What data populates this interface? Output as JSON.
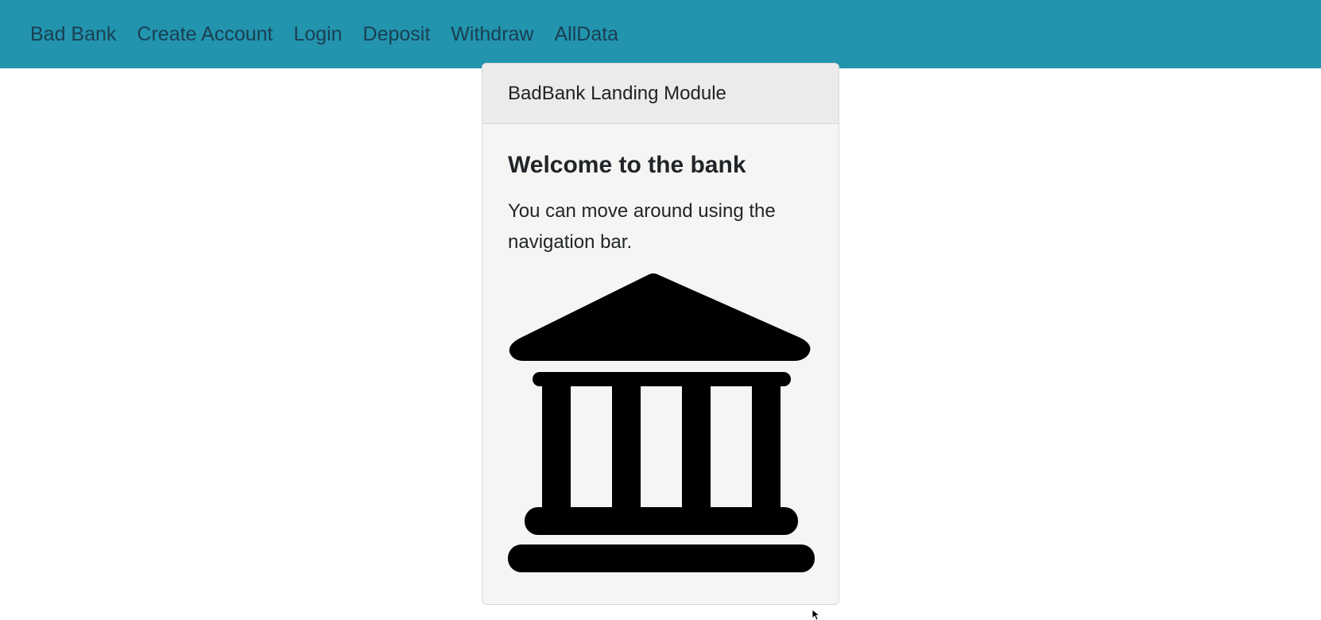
{
  "navbar": {
    "brand": "Bad Bank",
    "links": [
      {
        "label": "Create Account"
      },
      {
        "label": "Login"
      },
      {
        "label": "Deposit"
      },
      {
        "label": "Withdraw"
      },
      {
        "label": "AllData"
      }
    ]
  },
  "card": {
    "header": "BadBank Landing Module",
    "title": "Welcome to the bank",
    "text": "You can move around using the navigation bar.",
    "image_icon": "bank-building-icon"
  },
  "colors": {
    "navbar_bg": "#2294ae",
    "nav_link": "#1a3f52",
    "card_bg": "#f5f5f3",
    "card_header_bg": "#ebebeb",
    "icon": "#000000"
  }
}
